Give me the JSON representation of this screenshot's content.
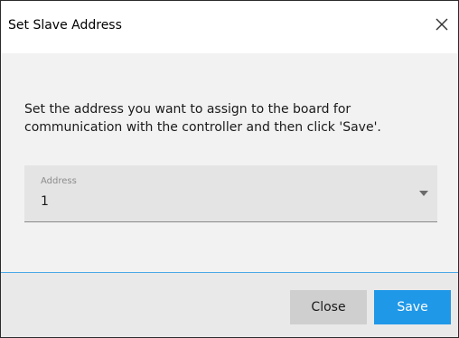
{
  "dialog": {
    "title": "Set Slave Address",
    "close_icon": "close-icon",
    "message": "Set the address you want to assign to the board for communication with the controller and then click 'Save'.",
    "address_field": {
      "label": "Address",
      "value": "1",
      "icon": "chevron-down-icon"
    },
    "buttons": {
      "close_label": "Close",
      "save_label": "Save"
    }
  },
  "colors": {
    "accent": "#1f98e8",
    "divider": "#4aa8e6",
    "content_background": "#f2f2f2",
    "footer_background": "#e9e9e9",
    "field_background": "#e4e4e4"
  }
}
